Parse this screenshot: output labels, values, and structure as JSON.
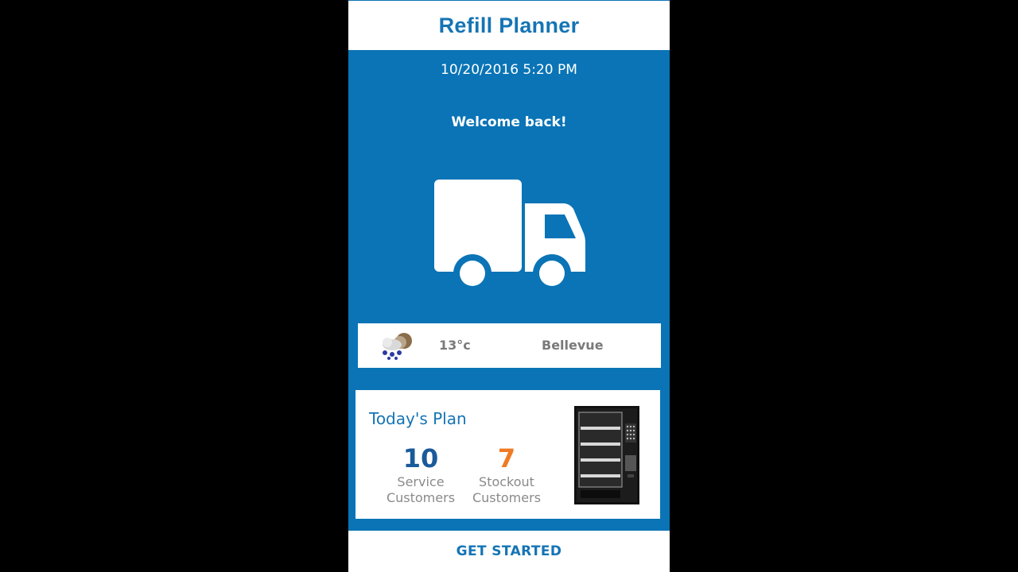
{
  "header": {
    "title": "Refill Planner"
  },
  "status": {
    "datetime": "10/20/2016 5:20 PM",
    "greeting": "Welcome back!"
  },
  "hero": {
    "icon": "truck-icon"
  },
  "weather": {
    "icon": "rain-cloud-icon",
    "temperature": "13°c",
    "city": "Bellevue"
  },
  "plan": {
    "title": "Today's Plan",
    "service": {
      "count": "10",
      "label_line1": "Service",
      "label_line2": "Customers"
    },
    "stockout": {
      "count": "7",
      "label_line1": "Stockout",
      "label_line2": "Customers"
    },
    "image": "vending-machine-icon"
  },
  "footer": {
    "cta": "GET STARTED"
  },
  "colors": {
    "brand_blue": "#0a74b6",
    "title_blue": "#1574b4",
    "count_blue": "#1a5a9a",
    "count_orange": "#ef7b24"
  }
}
